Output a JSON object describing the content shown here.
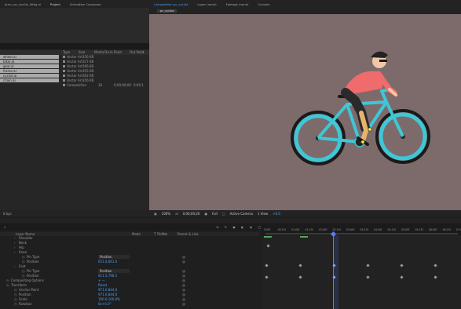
{
  "app": {
    "project_tab_title": "dunu_pc_cyclist_liftkg.ai",
    "project_tab": "Project",
    "animation_composer_tab": "Animation Composer",
    "comp_tab": "Composition pc_cyclist",
    "comp_subtab": "pc_cyclist",
    "layer_tab": "Layer (none)",
    "footage_tab": "Footage (none)",
    "console_tab": "Console"
  },
  "project": {
    "columns": [
      "Type",
      "Size",
      "Media Du",
      "In Point",
      "Out Point"
    ],
    "items": [
      {
        "name": "wheel.ai",
        "type": "Vector Art",
        "size": "356 KB",
        "media_dur": "",
        "in_point": "",
        "out_point": ""
      },
      {
        "name": "biker.ai",
        "type": "Vector Art",
        "size": "327 KB",
        "media_dur": "",
        "in_point": "",
        "out_point": ""
      },
      {
        "name": "gear.ai",
        "type": "Vector Art",
        "size": "396 KB",
        "media_dur": "",
        "in_point": "",
        "out_point": ""
      },
      {
        "name": "frame.ai",
        "type": "Vector Art",
        "size": "355 KB",
        "media_dur": "",
        "in_point": "",
        "out_point": ""
      },
      {
        "name": "cyclist.ai",
        "type": "Vector Art",
        "size": "362 KB",
        "media_dur": "",
        "in_point": "",
        "out_point": ""
      },
      {
        "name": "chain.ai",
        "type": "Vector Art",
        "size": "356 KB",
        "media_dur": "",
        "in_point": "",
        "out_point": ""
      },
      {
        "name": "",
        "type": "Composition",
        "size": "",
        "media_dur": "30",
        "in_point": "0;00;00;00",
        "out_point": "0;00;1"
      }
    ],
    "footer": "8 bpc"
  },
  "viewer": {
    "zoom": "100%",
    "timecode": "0;00;00;20",
    "resolution": "Full",
    "camera": "Active Camera",
    "view": "1 View",
    "offset": "+0.0"
  },
  "timeline": {
    "search_placeholder": "",
    "columns": {
      "layer_name": "Layer Name",
      "mode": "Mode",
      "trkmat": "T TrkMat",
      "parent": "Parent & Link"
    },
    "ruler": [
      "0:00f",
      "00:15f",
      "01:00f",
      "01:15f",
      "02:00f",
      "02:15f",
      "03:00f",
      "03:15f",
      "04:00f",
      "04:15f",
      "05:00f",
      "05:15f",
      "06:00f",
      "06:15f",
      "07:00f"
    ],
    "layers": [
      {
        "indent": 1,
        "label": "Shoulder",
        "value": "",
        "type": "text"
      },
      {
        "indent": 1,
        "label": "Neck",
        "value": "",
        "type": "text"
      },
      {
        "indent": 1,
        "label": "Hip",
        "value": "",
        "type": "text"
      },
      {
        "indent": 1,
        "label": "Knee",
        "value": "",
        "type": "text"
      },
      {
        "indent": 2,
        "label": "Pin Type",
        "value": "Position",
        "type": "dropdown"
      },
      {
        "indent": 2,
        "label": "Position",
        "value": "651.0,661.0",
        "type": "value"
      },
      {
        "indent": 1,
        "label": "Foot",
        "value": "",
        "type": "text"
      },
      {
        "indent": 2,
        "label": "Pin Type",
        "value": "Position",
        "type": "dropdown"
      },
      {
        "indent": 2,
        "label": "Position",
        "value": "611.5,798.5",
        "type": "value"
      },
      {
        "indent": 0,
        "label": "Compositing Options",
        "value": "+ —",
        "type": "value"
      },
      {
        "indent": 0,
        "label": "Transform",
        "value": "Reset",
        "type": "value"
      },
      {
        "indent": 1,
        "label": "Anchor Point",
        "value": "971.0,844.0",
        "type": "value"
      },
      {
        "indent": 1,
        "label": "Position",
        "value": "971.0,844.0",
        "type": "value"
      },
      {
        "indent": 1,
        "label": "Scale",
        "value": "100.0,100.0%",
        "type": "value"
      },
      {
        "indent": 1,
        "label": "Rotation",
        "value": "0x+0.0°",
        "type": "value"
      }
    ]
  }
}
